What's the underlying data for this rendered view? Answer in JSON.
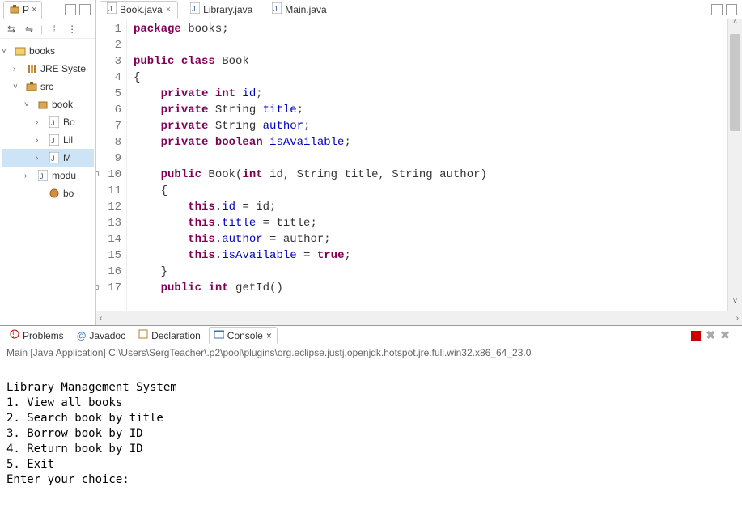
{
  "sidebar": {
    "tab_label": "P",
    "tree": {
      "project": "books",
      "jre": "JRE Syste",
      "src": "src",
      "package": "book",
      "file_bo": "Bo",
      "file_lil": "Lil",
      "file_m": "M",
      "module": "modu",
      "bo2": "bo"
    }
  },
  "editor": {
    "tabs": [
      {
        "label": "Book.java",
        "active": true
      },
      {
        "label": "Library.java",
        "active": false
      },
      {
        "label": "Main.java",
        "active": false
      }
    ],
    "line_numbers": [
      "1",
      "2",
      "3",
      "4",
      "5",
      "6",
      "7",
      "8",
      "9",
      "10",
      "11",
      "12",
      "13",
      "14",
      "15",
      "16",
      "17"
    ]
  },
  "code": {
    "l1_pkg": "package",
    "l1_rest": " books;",
    "l3_public": "public",
    "l3_class": " class",
    "l3_rest": " Book",
    "l4": "{",
    "l5_priv": "private",
    "l5_int": " int",
    "l5_fld": " id",
    "l5_semi": ";",
    "l6_priv": "private",
    "l6_type": " String ",
    "l6_fld": "title",
    "l7_priv": "private",
    "l7_type": " String ",
    "l7_fld": "author",
    "l8_priv": "private",
    "l8_bool": " boolean",
    "l8_fld": " isAvailable",
    "l10_public": "public",
    "l10_name": " Book(",
    "l10_int": "int",
    "l10_p1": " id, String title, String author)",
    "l11": "{",
    "l12_this": "this",
    "l12_dot": ".",
    "l12_fld": "id",
    "l12_rest": " = id;",
    "l13_this": "this",
    "l13_fld": "title",
    "l13_rest": " = title;",
    "l14_this": "this",
    "l14_fld": "author",
    "l14_rest": " = author;",
    "l15_this": "this",
    "l15_fld": "isAvailable",
    "l15_eq": " = ",
    "l15_true": "true",
    "l15_semi": ";",
    "l16": "}",
    "l17_public": "public",
    "l17_int": " int",
    "l17_rest": " getId()"
  },
  "bottom": {
    "tabs": {
      "problems": "Problems",
      "javadoc": "Javadoc",
      "declaration": "Declaration",
      "console": "Console"
    },
    "run_desc": "Main [Java Application] C:\\Users\\SergTeacher\\.p2\\pool\\plugins\\org.eclipse.justj.openjdk.hotspot.jre.full.win32.x86_64_23.0",
    "output": "\nLibrary Management System\n1. View all books\n2. Search book by title\n3. Borrow book by ID\n4. Return book by ID\n5. Exit\nEnter your choice: "
  }
}
